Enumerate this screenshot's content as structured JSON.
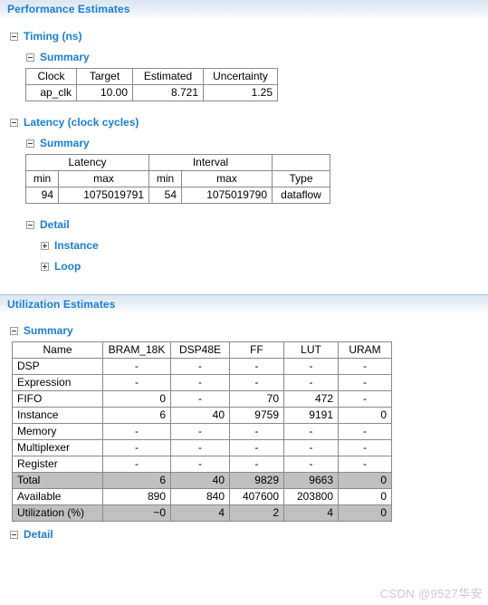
{
  "performance": {
    "header": "Performance Estimates",
    "timing": {
      "label": "Timing (ns)",
      "summary_label": "Summary",
      "columns": [
        "Clock",
        "Target",
        "Estimated",
        "Uncertainty"
      ],
      "rows": [
        [
          "ap_clk",
          "10.00",
          "8.721",
          "1.25"
        ]
      ]
    },
    "latency": {
      "label": "Latency (clock cycles)",
      "summary_label": "Summary",
      "group_headers": [
        "Latency",
        "Interval",
        ""
      ],
      "columns": [
        "min",
        "max",
        "min",
        "max",
        "Type"
      ],
      "rows": [
        [
          "94",
          "1075019791",
          "54",
          "1075019790",
          "dataflow"
        ]
      ],
      "detail_label": "Detail",
      "detail_items": [
        "Instance",
        "Loop"
      ]
    }
  },
  "utilization": {
    "header": "Utilization Estimates",
    "summary_label": "Summary",
    "columns": [
      "Name",
      "BRAM_18K",
      "DSP48E",
      "FF",
      "LUT",
      "URAM"
    ],
    "rows": [
      {
        "name": "DSP",
        "values": [
          "-",
          "-",
          "-",
          "-",
          "-"
        ],
        "highlight": false
      },
      {
        "name": "Expression",
        "values": [
          "-",
          "-",
          "-",
          "-",
          "-"
        ],
        "highlight": false
      },
      {
        "name": "FIFO",
        "values": [
          "0",
          "-",
          "70",
          "472",
          "-"
        ],
        "highlight": false
      },
      {
        "name": "Instance",
        "values": [
          "6",
          "40",
          "9759",
          "9191",
          "0"
        ],
        "highlight": false
      },
      {
        "name": "Memory",
        "values": [
          "-",
          "-",
          "-",
          "-",
          "-"
        ],
        "highlight": false
      },
      {
        "name": "Multiplexer",
        "values": [
          "-",
          "-",
          "-",
          "-",
          "-"
        ],
        "highlight": false
      },
      {
        "name": "Register",
        "values": [
          "-",
          "-",
          "-",
          "-",
          "-"
        ],
        "highlight": false
      },
      {
        "name": "Total",
        "values": [
          "6",
          "40",
          "9829",
          "9663",
          "0"
        ],
        "highlight": true
      },
      {
        "name": "Available",
        "values": [
          "890",
          "840",
          "407600",
          "203800",
          "0"
        ],
        "highlight": false
      },
      {
        "name": "Utilization (%)",
        "values": [
          "~0",
          "4",
          "2",
          "4",
          "0"
        ],
        "highlight": true
      }
    ],
    "detail_label": "Detail"
  },
  "watermark": "CSDN @9527华安",
  "colors": {
    "link_blue": "#1a7fd4",
    "header_bar_top": "#dce6f1",
    "table_border": "#8a8a8a",
    "highlight_row": "#c0c0c0"
  }
}
